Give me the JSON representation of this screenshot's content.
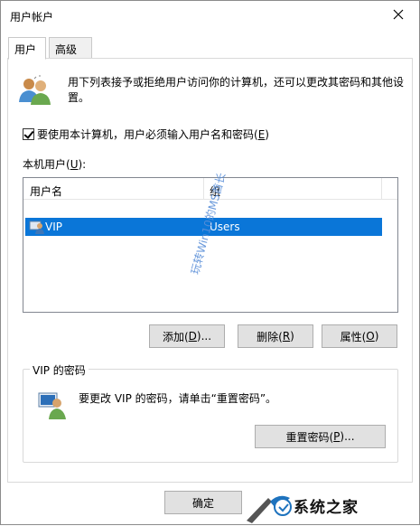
{
  "window": {
    "title": "用户帐户"
  },
  "tabs": [
    {
      "label": "用户"
    },
    {
      "label": "高级"
    }
  ],
  "intro": {
    "text": "用下列表接予或拒绝用户访问你的计算机，还可以更改其密码和其他设置。"
  },
  "checkbox": {
    "label": "要使用本计算机，用户必须输入用户名和密码(",
    "accel": "E",
    "label_end": ")",
    "checked": true
  },
  "users_list": {
    "label": "本机用户(",
    "accel": "U",
    "label_end": "):",
    "columns": [
      "用户名",
      "组"
    ],
    "rows": [
      {
        "name": "VIP",
        "group": "Users",
        "selected": true
      }
    ]
  },
  "buttons": {
    "add": {
      "text": "添加(",
      "accel": "D",
      "end": ")..."
    },
    "remove": {
      "text": "删除(",
      "accel": "R",
      "end": ")"
    },
    "properties": {
      "text": "属性(",
      "accel": "O",
      "end": ")"
    },
    "reset_password": {
      "text": "重置密码(",
      "accel": "P",
      "end": ")..."
    },
    "ok": {
      "text": "确定"
    }
  },
  "password_group": {
    "title": "VIP 的密码",
    "text": "要更改 VIP 的密码，请单击“重置密码”。"
  },
  "watermark": {
    "text": "玩转Win10的MS酋长"
  },
  "logo": {
    "text": "系统之家"
  },
  "colors": {
    "selection": "#0a76d8",
    "accent": "#0078d7",
    "watermark": "#5a8fd8"
  }
}
